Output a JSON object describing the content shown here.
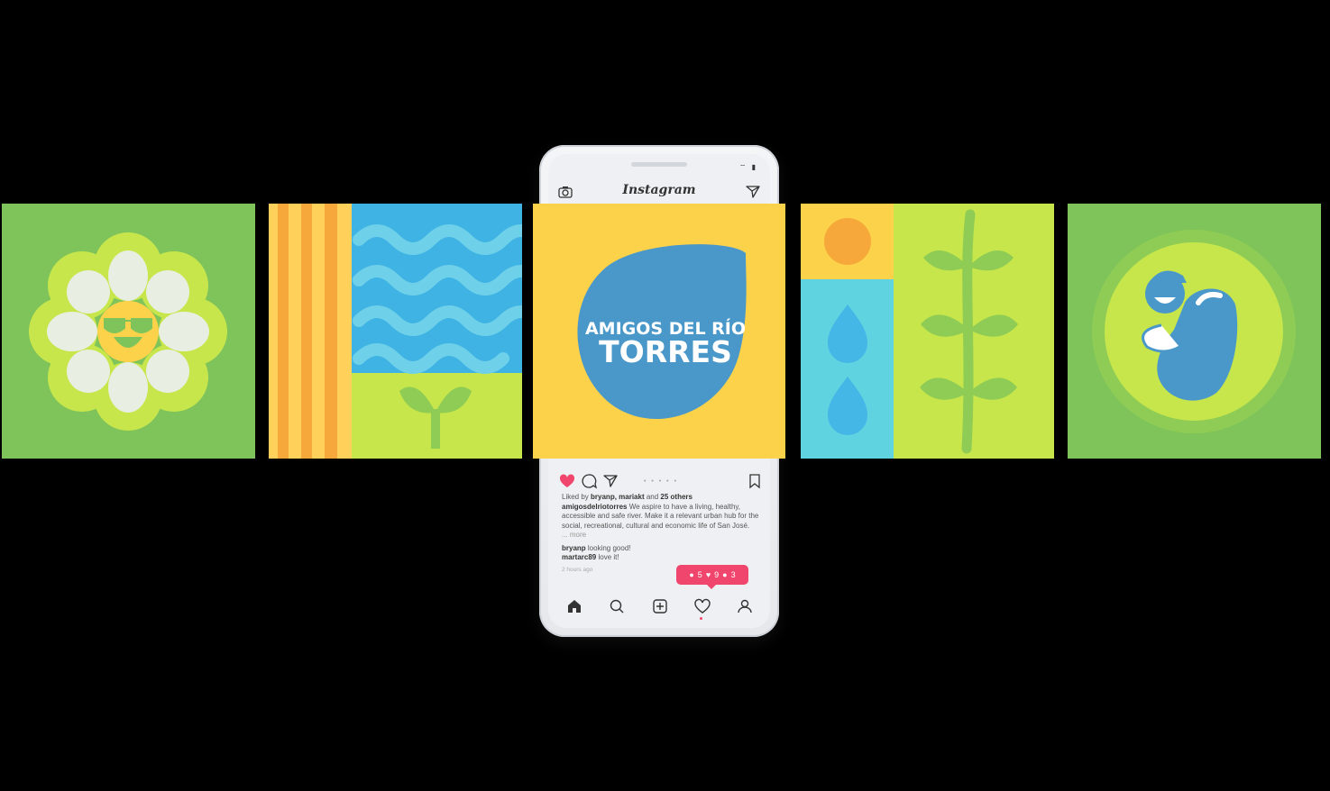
{
  "phone": {
    "app_title": "Instagram",
    "post": {
      "image_text_line1": "AMIGOS DEL RÍO",
      "image_text_line2": "TORRES",
      "liked_by_prefix": "Liked by ",
      "liked_by_users": "bryanp, mariakt",
      "liked_by_and": " and ",
      "liked_by_others": "25 others",
      "author": "amigosdelriotorres",
      "caption": " We aspire to have a living, healthy, accessible and safe river. Make it a relevant urban hub for the social, recreational, cultural and economic life of San José.",
      "more": "... more",
      "comments": [
        {
          "user": "bryanp",
          "text": " looking good!"
        },
        {
          "user": "martarc89",
          "text": " love it!"
        }
      ],
      "timestamp": "2 hours ago",
      "carousel_dots": "• • • • •"
    },
    "notification": {
      "comments": "5",
      "likes": "9",
      "follows": "3"
    },
    "status": "⌔ ▮"
  },
  "colors": {
    "brand_yellow": "#fdd24b",
    "brand_blue": "#4a98c9",
    "green": "#7ec45a",
    "lime": "#c6e64b",
    "like_red": "#f0456c"
  },
  "icons": [
    "camera-icon",
    "send-icon",
    "heart-icon",
    "comment-icon",
    "share-icon",
    "bookmark-icon",
    "home-icon",
    "search-icon",
    "add-icon",
    "activity-icon",
    "profile-icon"
  ]
}
